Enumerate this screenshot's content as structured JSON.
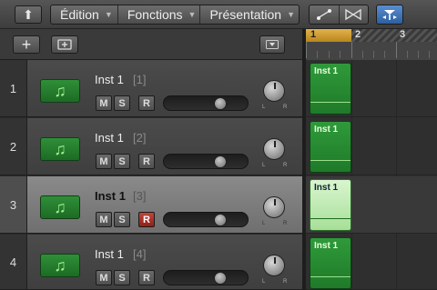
{
  "toolbar": {
    "menus": [
      {
        "label": "Édition"
      },
      {
        "label": "Fonctions"
      },
      {
        "label": "Présentation"
      }
    ]
  },
  "ruler": {
    "bars": [
      "1",
      "2",
      "3"
    ]
  },
  "tracks": [
    {
      "number": "1",
      "name": "Inst 1",
      "index": "[1]",
      "mute": "M",
      "solo": "S",
      "record": "R",
      "record_armed": false,
      "volume_level": 0.7,
      "selected": false
    },
    {
      "number": "2",
      "name": "Inst 1",
      "index": "[2]",
      "mute": "M",
      "solo": "S",
      "record": "R",
      "record_armed": false,
      "volume_level": 0.7,
      "selected": false
    },
    {
      "number": "3",
      "name": "Inst 1",
      "index": "[3]",
      "mute": "M",
      "solo": "S",
      "record": "R",
      "record_armed": true,
      "volume_level": 0.7,
      "selected": true
    },
    {
      "number": "4",
      "name": "Inst 1",
      "index": "[4]",
      "mute": "M",
      "solo": "S",
      "record": "R",
      "record_armed": false,
      "volume_level": 0.7,
      "selected": false
    }
  ],
  "regions": [
    {
      "name": "Inst 1",
      "selected": false
    },
    {
      "name": "Inst 1",
      "selected": false
    },
    {
      "name": "Inst 1",
      "selected": true
    },
    {
      "name": "Inst 1",
      "selected": false
    }
  ],
  "pan_labels": {
    "left": "L",
    "right": "R"
  },
  "colors": {
    "region_green": "#2f9a3a",
    "record_red": "#c2443a",
    "cycle_yellow": "#e2b24d",
    "tool_blue": "#3b76c0"
  }
}
